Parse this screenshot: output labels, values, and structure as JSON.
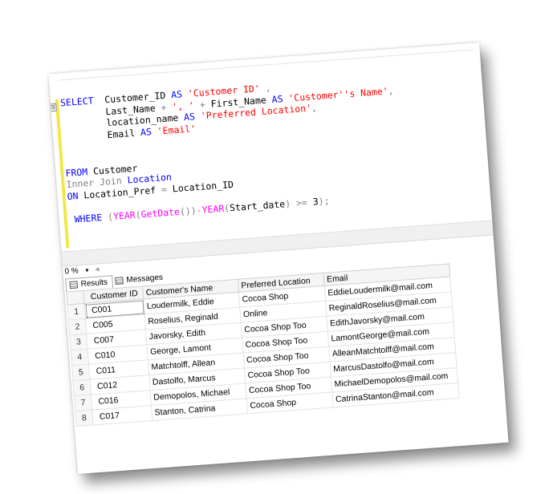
{
  "editor": {
    "collapse_glyph": "⊟",
    "lines": [
      [
        {
          "t": "SELECT  ",
          "c": "kw"
        },
        {
          "t": "Customer_ID ",
          "c": ""
        },
        {
          "t": "AS ",
          "c": "kw"
        },
        {
          "t": "'Customer ID'",
          "c": "str"
        },
        {
          "t": " ,",
          "c": "gray"
        }
      ],
      [
        {
          "t": "        Last_Name ",
          "c": ""
        },
        {
          "t": "+ ",
          "c": "gray"
        },
        {
          "t": "', '",
          "c": "str"
        },
        {
          "t": " + ",
          "c": "gray"
        },
        {
          "t": "First_Name ",
          "c": ""
        },
        {
          "t": "AS ",
          "c": "kw"
        },
        {
          "t": "'Customer''s Name'",
          "c": "str"
        },
        {
          "t": ",",
          "c": "gray"
        }
      ],
      [
        {
          "t": "        location_name ",
          "c": ""
        },
        {
          "t": "AS ",
          "c": "kw"
        },
        {
          "t": "'Preferred Location'",
          "c": "str"
        },
        {
          "t": ",",
          "c": "gray"
        }
      ],
      [
        {
          "t": "        Email ",
          "c": ""
        },
        {
          "t": "AS ",
          "c": "kw"
        },
        {
          "t": "'Email'",
          "c": "str"
        }
      ],
      [],
      [],
      [
        {
          "t": "FROM ",
          "c": "kw"
        },
        {
          "t": "Customer",
          "c": ""
        }
      ],
      [
        {
          "t": "Inner Join ",
          "c": "gray"
        },
        {
          "t": "Location",
          "c": "kw"
        }
      ],
      [
        {
          "t": "ON ",
          "c": "kw"
        },
        {
          "t": "Location_Pref ",
          "c": ""
        },
        {
          "t": "= ",
          "c": "gray"
        },
        {
          "t": "Location_ID",
          "c": ""
        }
      ],
      [],
      [
        {
          "t": " WHERE ",
          "c": "kw"
        },
        {
          "t": "(",
          "c": "gray"
        },
        {
          "t": "YEAR",
          "c": "fn"
        },
        {
          "t": "(",
          "c": "gray"
        },
        {
          "t": "GetDate",
          "c": "fn"
        },
        {
          "t": "())-",
          "c": "gray"
        },
        {
          "t": "YEAR",
          "c": "fn"
        },
        {
          "t": "(",
          "c": "gray"
        },
        {
          "t": "Start_date",
          "c": ""
        },
        {
          "t": ") >= ",
          "c": "gray"
        },
        {
          "t": "3",
          "c": ""
        },
        {
          "t": ");",
          "c": "gray"
        }
      ]
    ]
  },
  "zoom": {
    "value": "0 %",
    "arrow": "▾",
    "scroll_left": "◂"
  },
  "tabs": {
    "results": "Results",
    "messages": "Messages"
  },
  "grid": {
    "columns": [
      "Customer ID",
      "Customer's Name",
      "Preferred Location",
      "Email"
    ],
    "rows": [
      {
        "n": "1",
        "cells": [
          "C001",
          "Loudermilk, Eddie",
          "Cocoa Shop",
          "EddieLoudermilk@mail.com"
        ]
      },
      {
        "n": "2",
        "cells": [
          "C005",
          "Roselius, Reginald",
          "Online",
          "ReginaldRoselius@mail.com"
        ]
      },
      {
        "n": "3",
        "cells": [
          "C007",
          "Javorsky, Edith",
          "Cocoa Shop Too",
          "EdithJavorsky@mail.com"
        ]
      },
      {
        "n": "4",
        "cells": [
          "C010",
          "George, Lamont",
          "Cocoa Shop Too",
          "LamontGeorge@mail.com"
        ]
      },
      {
        "n": "5",
        "cells": [
          "C011",
          "Matchtolff, Allean",
          "Cocoa Shop Too",
          "AlleanMatchtolff@mail.com"
        ]
      },
      {
        "n": "6",
        "cells": [
          "C012",
          "Dastolfo, Marcus",
          "Cocoa Shop Too",
          "MarcusDastolfo@mail.com"
        ]
      },
      {
        "n": "7",
        "cells": [
          "C016",
          "Demopolos, Michael",
          "Cocoa Shop Too",
          "MichaelDemopolos@mail.com"
        ]
      },
      {
        "n": "8",
        "cells": [
          "C017",
          "Stanton, Catrina",
          "Cocoa Shop",
          "CatrinaStanton@mail.com"
        ]
      }
    ]
  },
  "colors": {
    "keyword": "#0000ff",
    "string": "#ff0000",
    "function": "#ff00ff",
    "operator": "#808080",
    "margin_marker": "#f2e64a"
  }
}
